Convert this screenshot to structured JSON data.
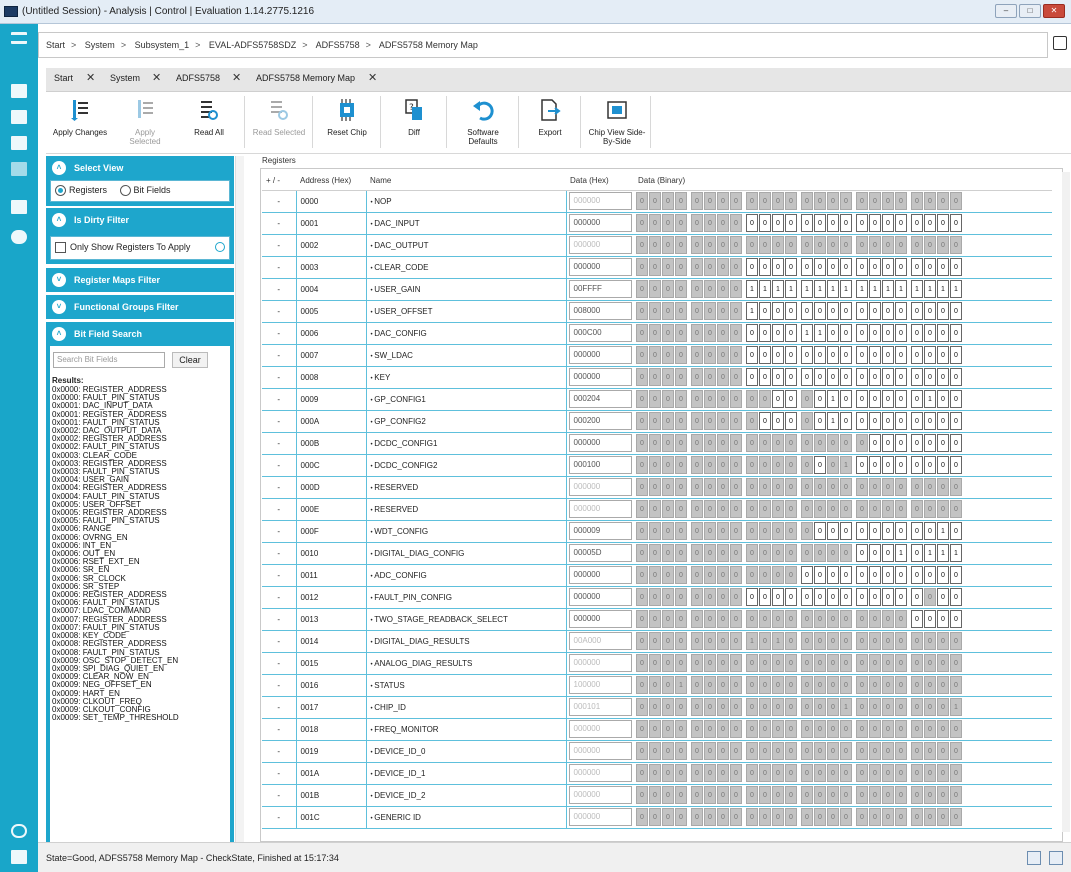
{
  "window": {
    "title": "(Untitled Session) - Analysis | Control | Evaluation 1.14.2775.1216"
  },
  "breadcrumb": [
    "Start",
    "System",
    "Subsystem_1",
    "EVAL-ADFS5758SDZ",
    "ADFS5758",
    "ADFS5758 Memory Map"
  ],
  "tabs": [
    {
      "label": "Start"
    },
    {
      "label": "System"
    },
    {
      "label": "ADFS5758"
    },
    {
      "label": "ADFS5758 Memory Map"
    }
  ],
  "toolbar": [
    {
      "label": "Apply Changes",
      "enabled": true,
      "icon": "apply-changes-icon"
    },
    {
      "label": "Apply Selected",
      "enabled": false,
      "icon": "apply-selected-icon"
    },
    {
      "label": "Read All",
      "enabled": true,
      "icon": "read-all-icon"
    },
    {
      "label": "Read Selected",
      "enabled": false,
      "icon": "read-selected-icon"
    },
    {
      "label": "Reset Chip",
      "enabled": true,
      "icon": "reset-chip-icon"
    },
    {
      "label": "Diff",
      "enabled": true,
      "icon": "diff-icon"
    },
    {
      "label": "Software Defaults",
      "enabled": true,
      "icon": "undo-icon"
    },
    {
      "label": "Export",
      "enabled": true,
      "icon": "export-icon"
    },
    {
      "label": "Chip View Side-By-Side",
      "enabled": true,
      "icon": "chip-view-icon"
    }
  ],
  "leftpanel": {
    "select_view": "Select View",
    "view_registers": "Registers",
    "view_bitfields": "Bit Fields",
    "dirty_filter": "Is Dirty Filter",
    "only_show": "Only Show Registers To Apply",
    "register_maps_filter": "Register Maps Filter",
    "functional_groups_filter": "Functional Groups Filter",
    "bit_field_search": "Bit Field Search",
    "search_placeholder": "Search Bit Fields",
    "clear": "Clear",
    "results_label": "Results:",
    "results": [
      "0x0000: REGISTER_ADDRESS",
      "0x0000: FAULT_PIN_STATUS",
      "0x0001: DAC_INPUT_DATA",
      "0x0001: REGISTER_ADDRESS",
      "0x0001: FAULT_PIN_STATUS",
      "0x0002: DAC_OUTPUT_DATA",
      "0x0002: REGISTER_ADDRESS",
      "0x0002: FAULT_PIN_STATUS",
      "0x0003: CLEAR_CODE",
      "0x0003: REGISTER_ADDRESS",
      "0x0003: FAULT_PIN_STATUS",
      "0x0004: USER_GAIN",
      "0x0004: REGISTER_ADDRESS",
      "0x0004: FAULT_PIN_STATUS",
      "0x0005: USER_OFFSET",
      "0x0005: REGISTER_ADDRESS",
      "0x0005: FAULT_PIN_STATUS",
      "0x0006: RANGE",
      "0x0006: OVRNG_EN",
      "0x0006: INT_EN",
      "0x0006: OUT_EN",
      "0x0006: RSET_EXT_EN",
      "0x0006: SR_EN",
      "0x0006: SR_CLOCK",
      "0x0006: SR_STEP",
      "0x0006: REGISTER_ADDRESS",
      "0x0006: FAULT_PIN_STATUS",
      "0x0007: LDAC_COMMAND",
      "0x0007: REGISTER_ADDRESS",
      "0x0007: FAULT_PIN_STATUS",
      "0x0008: KEY_CODE",
      "0x0008: REGISTER_ADDRESS",
      "0x0008: FAULT_PIN_STATUS",
      "0x0009: OSC_STOP_DETECT_EN",
      "0x0009: SPI_DIAG_QUIET_EN",
      "0x0009: CLEAR_NOW_EN",
      "0x0009: NEG_OFFSET_EN",
      "0x0009: HART_EN",
      "0x0009: CLKOUT_FREQ",
      "0x0009: CLKOUT_CONFIG",
      "0x0009: SET_TEMP_THRESHOLD"
    ]
  },
  "registers_label": "Registers",
  "columns": {
    "sort": "+ / -",
    "address": "Address (Hex)",
    "name": "Name",
    "hex": "Data (Hex)",
    "binary": "Data (Binary)"
  },
  "rows": [
    {
      "addr": "0000",
      "name": "NOP",
      "hex": "000000",
      "hex_dim": true,
      "bits": "000000000000000000000000",
      "rw": "000000000000000000000000"
    },
    {
      "addr": "0001",
      "name": "DAC_INPUT",
      "hex": "000000",
      "hex_dim": false,
      "bits": "000000000000000000000000",
      "rw": "000000001111111111111111"
    },
    {
      "addr": "0002",
      "name": "DAC_OUTPUT",
      "hex": "000000",
      "hex_dim": true,
      "bits": "000000000000000000000000",
      "rw": "000000000000000000000000"
    },
    {
      "addr": "0003",
      "name": "CLEAR_CODE",
      "hex": "000000",
      "hex_dim": false,
      "bits": "000000000000000000000000",
      "rw": "000000001111111111111111"
    },
    {
      "addr": "0004",
      "name": "USER_GAIN",
      "hex": "00FFFF",
      "hex_dim": false,
      "bits": "000000001111111111111111",
      "rw": "000000001111111111111111"
    },
    {
      "addr": "0005",
      "name": "USER_OFFSET",
      "hex": "008000",
      "hex_dim": false,
      "bits": "000000001000000000000000",
      "rw": "000000001111111111111111"
    },
    {
      "addr": "0006",
      "name": "DAC_CONFIG",
      "hex": "000C00",
      "hex_dim": false,
      "bits": "000000000000110000000000",
      "rw": "000000001111111111111111"
    },
    {
      "addr": "0007",
      "name": "SW_LDAC",
      "hex": "000000",
      "hex_dim": false,
      "bits": "000000000000000000000000",
      "rw": "000000001111111111111111"
    },
    {
      "addr": "0008",
      "name": "KEY",
      "hex": "000000",
      "hex_dim": false,
      "bits": "000000000000000000000000",
      "rw": "000000001111111111111111"
    },
    {
      "addr": "0009",
      "name": "GP_CONFIG1",
      "hex": "000204",
      "hex_dim": false,
      "bits": "000000000000001000000100",
      "rw": "000000000011011111111111"
    },
    {
      "addr": "000A",
      "name": "GP_CONFIG2",
      "hex": "000200",
      "hex_dim": false,
      "bits": "000000000000001000000000",
      "rw": "000000000111011111111111"
    },
    {
      "addr": "000B",
      "name": "DCDC_CONFIG1",
      "hex": "000000",
      "hex_dim": false,
      "bits": "000000000000000000000000",
      "rw": "000000000000000001111111"
    },
    {
      "addr": "000C",
      "name": "DCDC_CONFIG2",
      "hex": "000100",
      "hex_dim": false,
      "bits": "000000000000000100000000",
      "rw": "000000000000010011111111"
    },
    {
      "addr": "000D",
      "name": "RESERVED",
      "hex": "000000",
      "hex_dim": true,
      "bits": "000000000000000000000000",
      "rw": "000000000000000000000000"
    },
    {
      "addr": "000E",
      "name": "RESERVED",
      "hex": "000000",
      "hex_dim": true,
      "bits": "000000000000000000000000",
      "rw": "000000000000000000000000"
    },
    {
      "addr": "000F",
      "name": "WDT_CONFIG",
      "hex": "000009",
      "hex_dim": false,
      "bits": "000000000000000000000010",
      "rw": "000000000000011111111111"
    },
    {
      "addr": "0010",
      "name": "DIGITAL_DIAG_CONFIG",
      "hex": "00005D",
      "hex_dim": false,
      "bits": "000000000000000000010111",
      "rw": "000000000000000011111111"
    },
    {
      "addr": "0011",
      "name": "ADC_CONFIG",
      "hex": "000000",
      "hex_dim": false,
      "bits": "000000000000000000000000",
      "rw": "000000000000111111111111"
    },
    {
      "addr": "0012",
      "name": "FAULT_PIN_CONFIG",
      "hex": "000000",
      "hex_dim": false,
      "bits": "000000000000000000000000",
      "rw": "000000001111111111111011"
    },
    {
      "addr": "0013",
      "name": "TWO_STAGE_READBACK_SELECT",
      "hex": "000000",
      "hex_dim": false,
      "bits": "000000000000000000000000",
      "rw": "000000000000000000001111"
    },
    {
      "addr": "0014",
      "name": "DIGITAL_DIAG_RESULTS",
      "hex": "00A000",
      "hex_dim": true,
      "bits": "000000001010000000000000",
      "rw": "000000000000000000000000"
    },
    {
      "addr": "0015",
      "name": "ANALOG_DIAG_RESULTS",
      "hex": "000000",
      "hex_dim": true,
      "bits": "000000000000000000000000",
      "rw": "000000000000000000000000"
    },
    {
      "addr": "0016",
      "name": "STATUS",
      "hex": "100000",
      "hex_dim": true,
      "bits": "000100000000000000000000",
      "rw": "000000000000000000000000"
    },
    {
      "addr": "0017",
      "name": "CHIP_ID",
      "hex": "000101",
      "hex_dim": true,
      "bits": "000000000000000100000001",
      "rw": "000000000000000000000000"
    },
    {
      "addr": "0018",
      "name": "FREQ_MONITOR",
      "hex": "000000",
      "hex_dim": true,
      "bits": "000000000000000000000000",
      "rw": "000000000000000000000000"
    },
    {
      "addr": "0019",
      "name": "DEVICE_ID_0",
      "hex": "000000",
      "hex_dim": true,
      "bits": "000000000000000000000000",
      "rw": "000000000000000000000000"
    },
    {
      "addr": "001A",
      "name": "DEVICE_ID_1",
      "hex": "000000",
      "hex_dim": true,
      "bits": "000000000000000000000000",
      "rw": "000000000000000000000000"
    },
    {
      "addr": "001B",
      "name": "DEVICE_ID_2",
      "hex": "000000",
      "hex_dim": true,
      "bits": "000000000000000000000000",
      "rw": "000000000000000000000000"
    },
    {
      "addr": "001C",
      "name": "GENERIC ID",
      "hex": "000000",
      "hex_dim": true,
      "bits": "000000000000000000000000",
      "rw": "000000000000000000000000"
    }
  ],
  "status": "State=Good, ADFS5758 Memory Map - CheckState, Finished at 15:17:34",
  "colors": {
    "accent": "#1ea6cc",
    "sidebar": "#19a6c9"
  }
}
